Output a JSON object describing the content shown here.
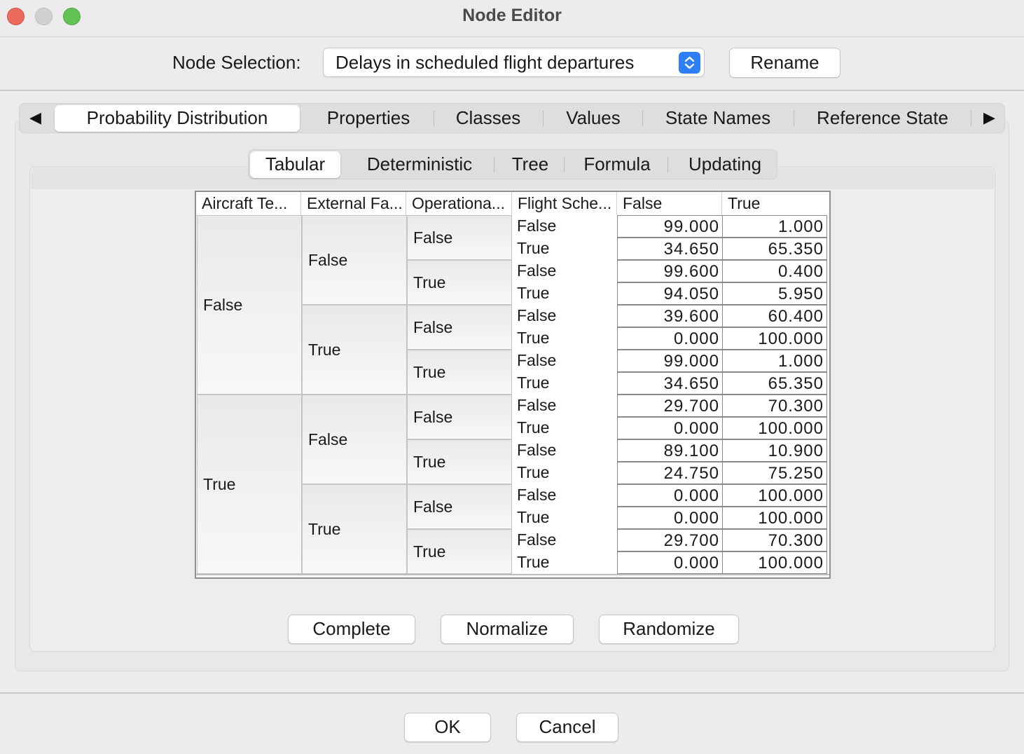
{
  "window": {
    "title": "Node Editor"
  },
  "node_selection": {
    "label": "Node Selection:",
    "value": "Delays in scheduled flight departures",
    "rename_label": "Rename"
  },
  "outer_tabs": {
    "items": [
      "Probability Distribution",
      "Properties",
      "Classes",
      "Values",
      "State Names",
      "Reference State"
    ],
    "active": "Probability Distribution"
  },
  "inner_tabs": {
    "items": [
      "Tabular",
      "Deterministic",
      "Tree",
      "Formula",
      "Updating"
    ],
    "active": "Tabular"
  },
  "table": {
    "headers": [
      "Aircraft Te...",
      "External Fa...",
      "Operationa...",
      "Flight Sche...",
      "False",
      "True"
    ],
    "parent1": [
      "False",
      "True"
    ],
    "parent2": [
      "False",
      "True",
      "False",
      "True"
    ],
    "parent3": [
      "False",
      "True",
      "False",
      "True",
      "False",
      "True",
      "False",
      "True"
    ],
    "parent4": [
      "False",
      "True",
      "False",
      "True",
      "False",
      "True",
      "False",
      "True",
      "False",
      "True",
      "False",
      "True",
      "False",
      "True",
      "False",
      "True"
    ],
    "values_false": [
      "99.000",
      "34.650",
      "99.600",
      "94.050",
      "39.600",
      "0.000",
      "99.000",
      "34.650",
      "29.700",
      "0.000",
      "89.100",
      "24.750",
      "0.000",
      "0.000",
      "29.700",
      "0.000"
    ],
    "values_true": [
      "1.000",
      "65.350",
      "0.400",
      "5.950",
      "60.400",
      "100.000",
      "1.000",
      "65.350",
      "70.300",
      "100.000",
      "10.900",
      "75.250",
      "100.000",
      "100.000",
      "70.300",
      "100.000"
    ]
  },
  "actions": {
    "complete": "Complete",
    "normalize": "Normalize",
    "randomize": "Randomize"
  },
  "dialog_buttons": {
    "ok": "OK",
    "cancel": "Cancel"
  }
}
